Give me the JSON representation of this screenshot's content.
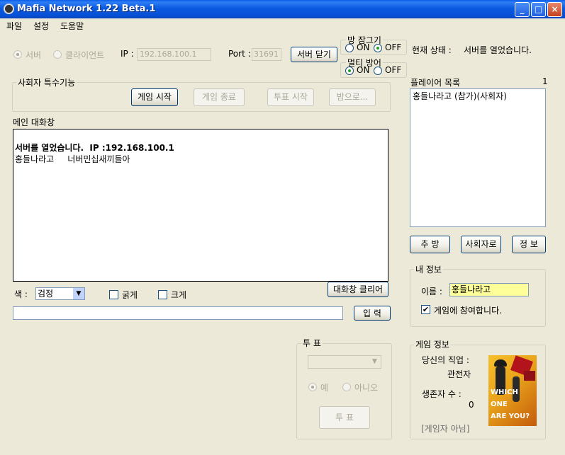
{
  "window": {
    "title": "Mafia Network 1.22 Beta.1",
    "minimize_label": "_",
    "maximize_label": "□",
    "close_label": "×"
  },
  "menu": {
    "items": [
      "파일",
      "설정",
      "도움말"
    ]
  },
  "connection": {
    "server_label": "서버",
    "client_label": "클라이언트",
    "ip_label": "IP :",
    "ip_value": "192.168.100.1",
    "port_label": "Port :",
    "port_value": "31691",
    "close_server_button": "서버 닫기"
  },
  "room_lock": {
    "title": "방 잠그기",
    "on_label": "ON",
    "off_label": "OFF",
    "selected": "OFF"
  },
  "multi_protect": {
    "title": "멀티 방어",
    "on_label": "ON",
    "off_label": "OFF",
    "selected": "ON"
  },
  "status": {
    "label": "현재 상태 :",
    "value": "서버를 열었습니다."
  },
  "host_functions": {
    "title": "사회자 특수기능",
    "buttons": [
      "게임 시작",
      "게임 종료",
      "투표 시작",
      "밤으로..."
    ]
  },
  "main_chat": {
    "title": "메인 대화창",
    "lines": [
      "서버를 열었습니다.  IP :192.168.100.1",
      "홍들나라고     너버민십새끼들아"
    ]
  },
  "chat_options": {
    "color_label": "색 :",
    "color_value": "검정",
    "bold_label": "굵게",
    "large_label": "크게",
    "clear_button": "대화창 클리어",
    "input_value": "",
    "send_button": "입 력"
  },
  "players": {
    "title": "플레이어 목록",
    "count": "1",
    "items": [
      "홍들나라고  (참가)(사회자)"
    ],
    "kick_button": "추 방",
    "host_button": "사회자로",
    "info_button": "정 보"
  },
  "my_info": {
    "title": "내 정보",
    "name_label": "이름 :",
    "name_value": "홍들나라고",
    "participate_label": "게임에 참여합니다.",
    "participate_checked": "✔"
  },
  "vote": {
    "title": "투 표",
    "select_value": "",
    "yes_label": "예",
    "no_label": "아니오",
    "vote_button": "투 표"
  },
  "game_info": {
    "title": "게임 정보",
    "job_label": "당신의 직업 :",
    "job_value": "관전자",
    "alive_label": "생존자 수 :",
    "alive_value": "0",
    "player_status": "[게임자 아님]",
    "poster_text": [
      "WHICH",
      "ONE",
      "ARE YOU?"
    ]
  },
  "colors": {
    "titlebar": "#0a5de8",
    "window_bg": "#ece9d8",
    "name_field_bg": "#ffff99"
  }
}
